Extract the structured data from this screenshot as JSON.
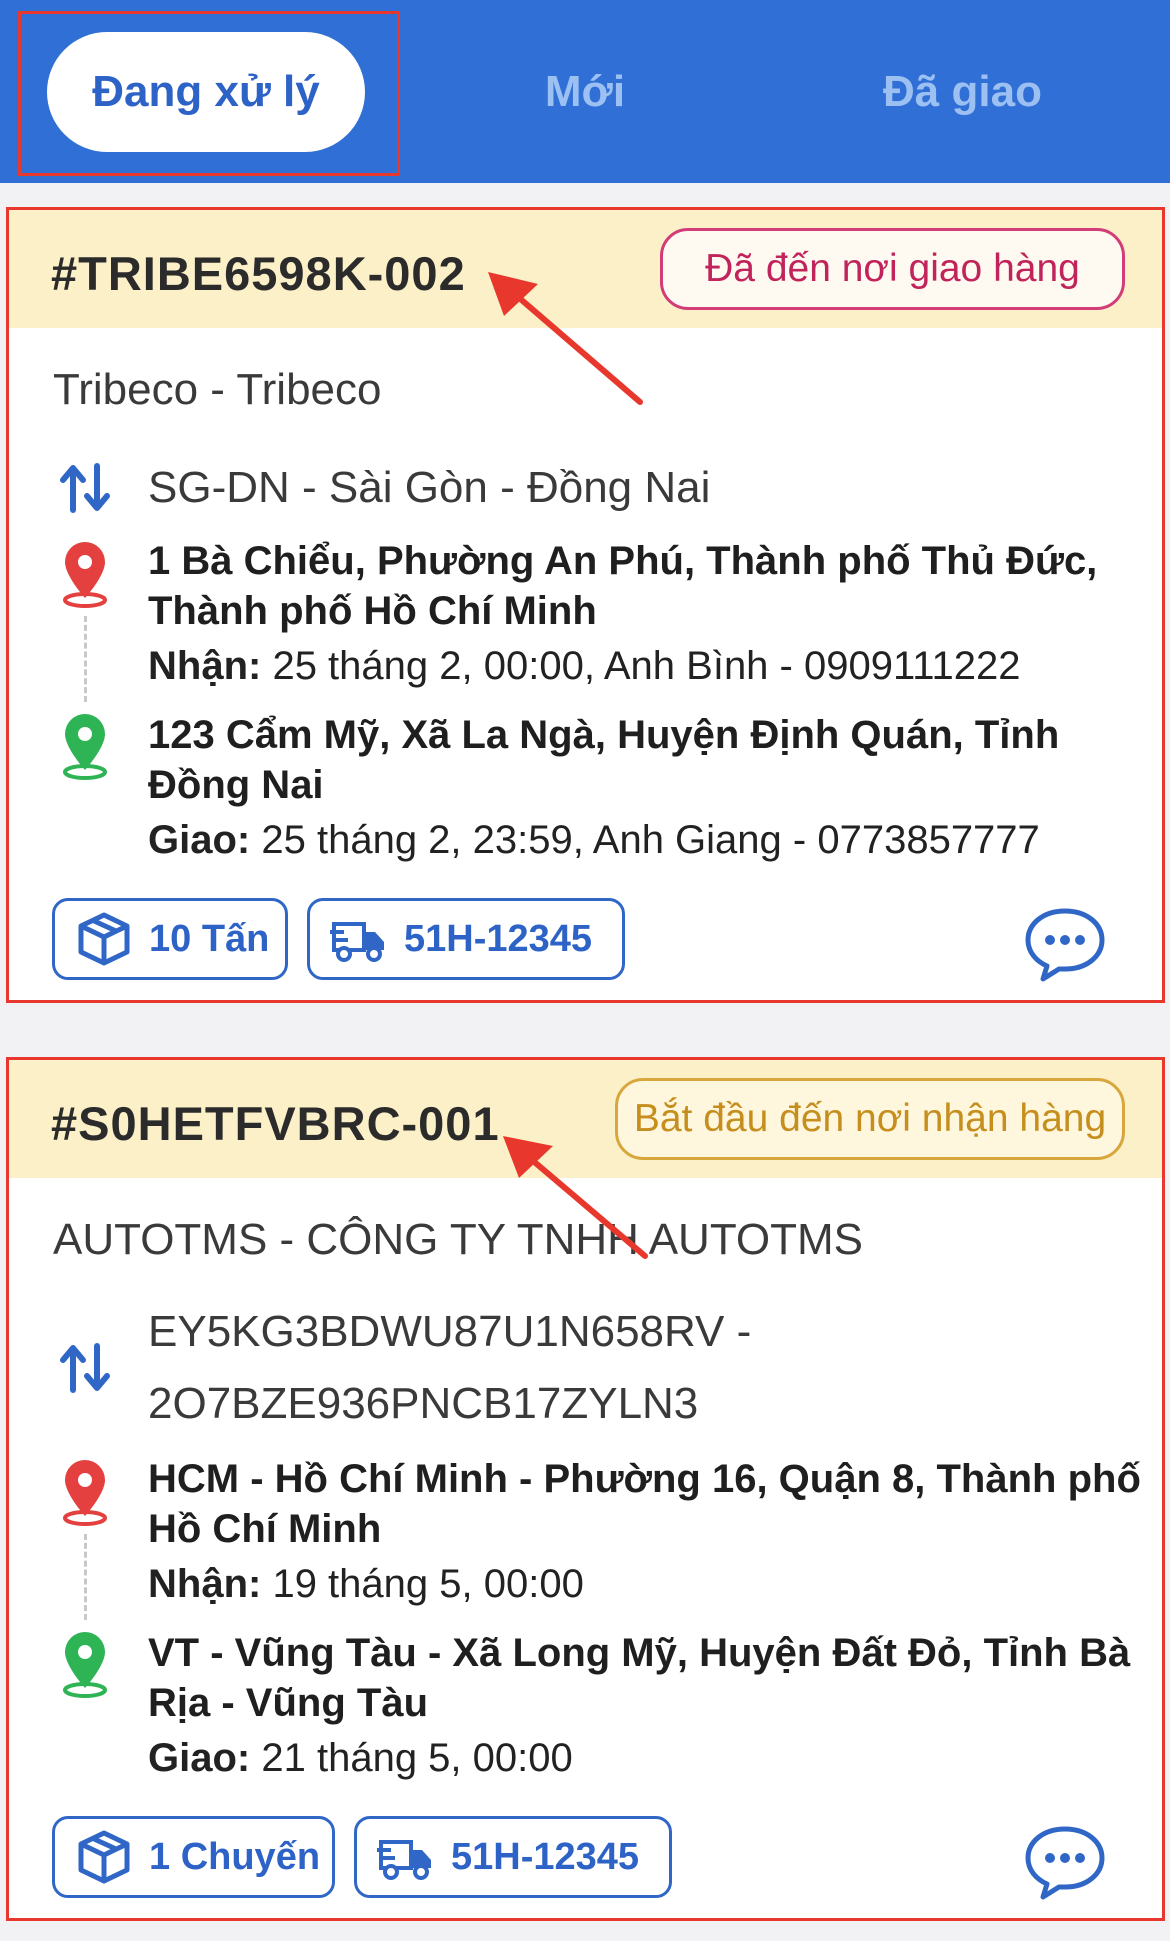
{
  "tabs": {
    "processing": "Đang xử lý",
    "new": "Mới",
    "delivered": "Đã giao"
  },
  "orders": [
    {
      "code": "#TRIBE6598K-002",
      "status": "Đã đến nơi giao hàng",
      "customer": "Tribeco - Tribeco",
      "route": "SG-DN - Sài Gòn - Đồng Nai",
      "pickup_address": "1 Bà Chiểu, Phường An Phú, Thành phố Thủ Đức, Thành phố Hồ Chí Minh",
      "pickup_label": "Nhận:",
      "pickup_detail": "25 tháng 2, 00:00, Anh Bình - 0909111222",
      "delivery_address": "123 Cẩm Mỹ, Xã La Ngà, Huyện Định Quán, Tỉnh Đồng Nai",
      "delivery_label": "Giao:",
      "delivery_detail": "25 tháng 2, 23:59, Anh Giang - 0773857777",
      "load": "10 Tấn",
      "plate": "51H-12345"
    },
    {
      "code": "#S0HETFVBRC-001",
      "status": "Bắt đầu đến nơi nhận hàng",
      "customer": "AUTOTMS - CÔNG TY TNHH AUTOTMS",
      "route_line1": "EY5KG3BDWU87U1N658RV -",
      "route_line2": "2O7BZE936PNCB17ZYLN3",
      "pickup_address": "HCM - Hồ Chí Minh - Phường 16, Quận 8, Thành phố Hồ Chí Minh",
      "pickup_label": "Nhận:",
      "pickup_detail": "19 tháng 5, 00:00",
      "delivery_address": "VT - Vũng Tàu - Xã Long Mỹ, Huyện Đất Đỏ, Tỉnh Bà Rịa - Vũng Tàu",
      "delivery_label": "Giao:",
      "delivery_detail": "21 tháng 5, 00:00",
      "load": "1 Chuyến",
      "plate": "51H-12345"
    }
  ],
  "icons": {
    "route": "route-swap-icon",
    "pickup": "pickup-pin-icon",
    "delivery": "delivery-pin-icon",
    "package": "package-box-icon",
    "truck": "truck-icon",
    "chat": "chat-bubble-icon"
  },
  "colors": {
    "primary": "#2f6fd6",
    "header_bg": "#fbf0c7",
    "pink_status": "#c0245b",
    "gold_status": "#c58e1d",
    "pin_red": "#e4403f",
    "pin_green": "#2fb455",
    "annotation": "#e8372c"
  }
}
